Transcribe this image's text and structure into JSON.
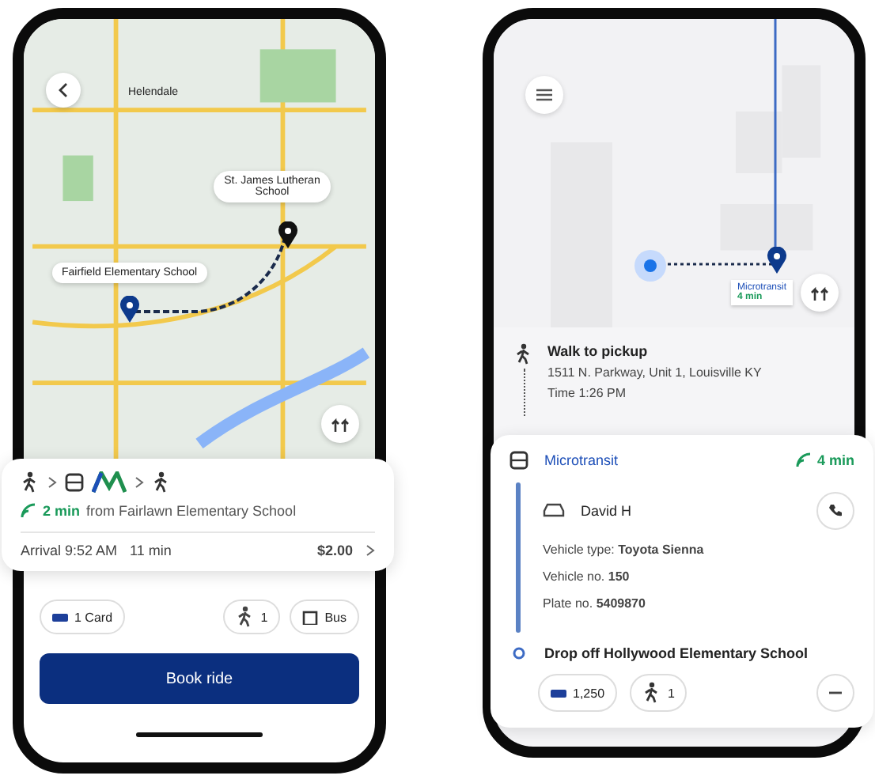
{
  "trip_options": {
    "map_labels": [
      {
        "kind": "place",
        "text": "Helendale"
      },
      {
        "kind": "destination",
        "text": "St. James Lutheran School"
      },
      {
        "kind": "origin",
        "text": "Fairfield Elementary School"
      }
    ],
    "route_modes": [
      {
        "kind": "walk"
      },
      {
        "kind": "microtransit"
      },
      {
        "kind": "walk"
      }
    ],
    "next_departure": {
      "wait": "2 min",
      "text": "from Fairlawn Elementary School"
    },
    "summary": {
      "arrival": "Arrival 9:52 AM",
      "duration": "11 min",
      "price": "$2.00"
    },
    "chips": [
      {
        "kind": "payment",
        "text": "1 Card"
      },
      {
        "kind": "riders",
        "text": "1"
      },
      {
        "kind": "bags",
        "text": "Bus"
      }
    ],
    "book_button": "Book ride"
  },
  "trip_details": {
    "map_tag": {
      "name": "Microtransit",
      "wait": "4 min"
    },
    "steps": [
      {
        "kind": "walk",
        "title": "Walk to pickup",
        "lines": [
          "1511 N. Parkway, Unit 1, Louisville KY",
          "Time 1:26 PM"
        ]
      }
    ],
    "ride": {
      "service": "Microtransit",
      "wait": "4 min",
      "driver": "David H",
      "vehicle_lines": [
        {
          "label": "Vehicle type: ",
          "value": "Toyota Sienna"
        },
        {
          "label": "Vehicle no. ",
          "value": "150"
        },
        {
          "label": "Plate no. ",
          "value": "5409870"
        }
      ],
      "dropoff": "Drop off Hollywood Elementary School",
      "chips": [
        {
          "kind": "payment",
          "text": "1,250"
        },
        {
          "kind": "riders",
          "text": "1"
        },
        {
          "kind": "more"
        }
      ]
    }
  }
}
